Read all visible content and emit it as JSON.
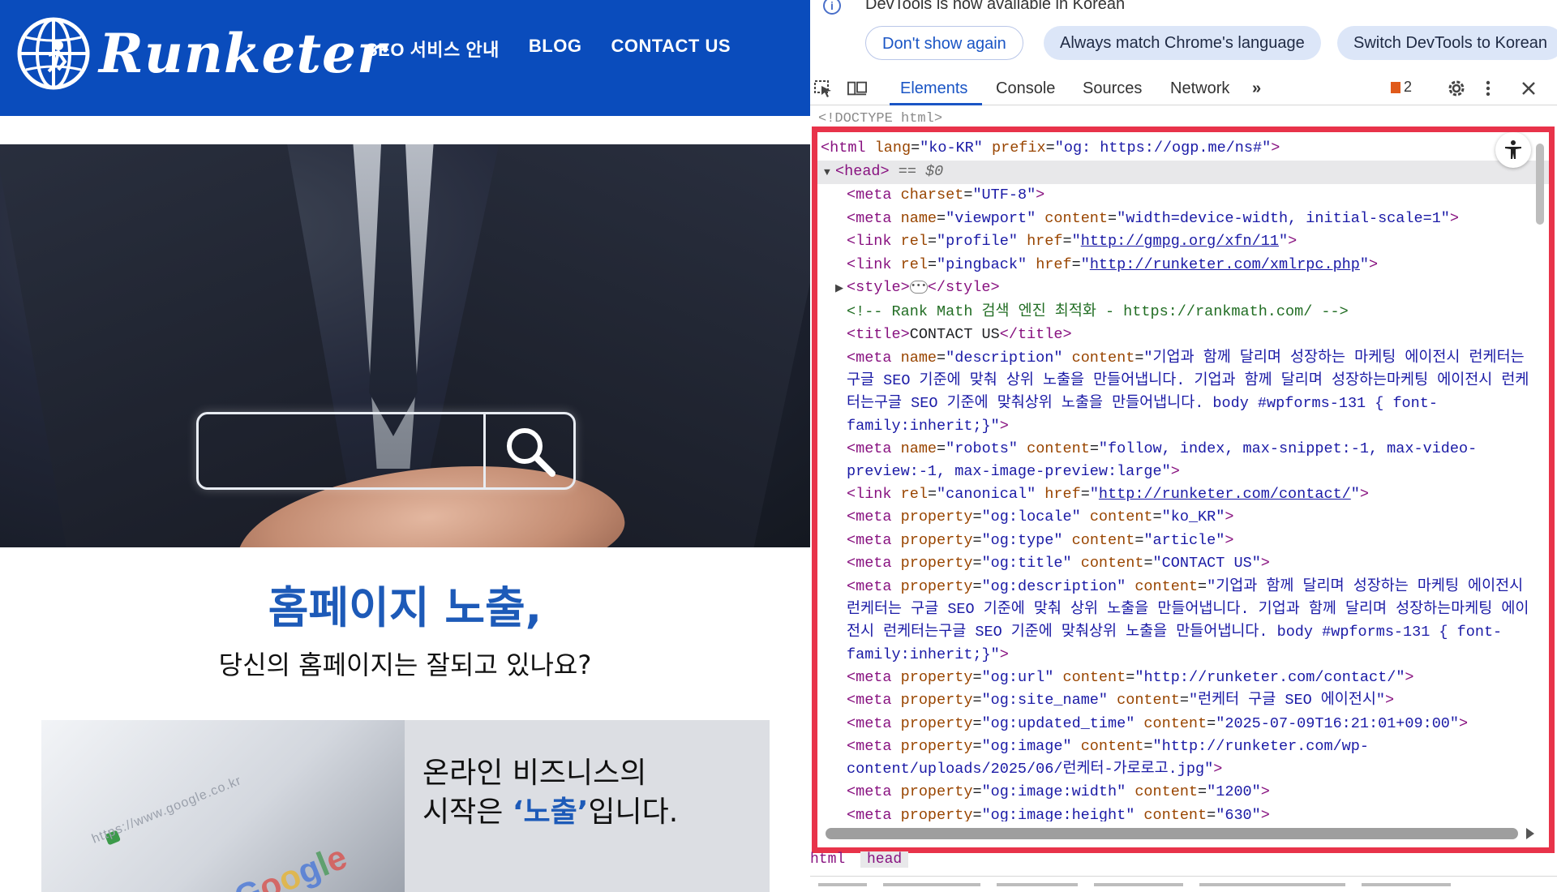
{
  "site": {
    "logo_text": "Runketer",
    "nav": [
      {
        "label": "SEO 서비스 안내"
      },
      {
        "label": "BLOG"
      },
      {
        "label": "CONTACT US"
      }
    ],
    "headline": "홈페이지 노출,",
    "subline": "당신의 홈페이지는 잘되고 있나요?",
    "card": {
      "line1": "온라인 비즈니스의",
      "line2_pre": "시작은 ",
      "line2_highlight": "‘노출’",
      "line2_post": "입니다.",
      "photo_url": "https://www.google.co.kr",
      "photo_brand": "Google"
    },
    "colors": {
      "brand": "#0a4cbc",
      "headline": "#1d5ab8"
    }
  },
  "devtools": {
    "infobar": {
      "message": "DevTools is now available in Korean",
      "buttons": [
        "Don't show again",
        "Always match Chrome's language",
        "Switch DevTools to Korean"
      ]
    },
    "tabs": [
      "Elements",
      "Console",
      "Sources",
      "Network"
    ],
    "active_tab": "Elements",
    "more_tabs": "»",
    "issues_count": "2",
    "doctype": "<!DOCTYPE html>",
    "dom": {
      "html": {
        "tag": "html",
        "attrs": "lang=\"ko-KR\" prefix=\"og: https://ogp.me/ns#\""
      },
      "head_tag": "head",
      "head_ref": "== $0",
      "lines": [
        {
          "tag": "meta",
          "a": "charset",
          "v": "\"UTF-8\""
        },
        {
          "tag": "meta",
          "a": "name",
          "v": "\"viewport\"",
          "a2": "content",
          "v2": "\"width=device-width, initial-scale=1\""
        },
        {
          "tag": "link",
          "a": "rel",
          "v": "\"profile\"",
          "a2": "href",
          "link": "http://gmpg.org/xfn/11"
        },
        {
          "tag": "link",
          "a": "rel",
          "v": "\"pingback\"",
          "a2": "href",
          "link": "http://runketer.com/xmlrpc.php"
        }
      ],
      "style_tag": "style",
      "comment": "<!-- Rank Math 검색 엔진 최적화 - https://rankmath.com/ -->",
      "title_text": "CONTACT US",
      "description": "기업과 함께 달리며 성장하는 마케팅 에이전시 런케터는 구글 SEO 기준에 맞춰 상위 노출을 만들어냅니다. 기업과 함께 달리며 성장하는마케팅 에이전시 런케터는구글 SEO 기준에 맞춰상위 노출을 만들어냅니다. body #wpforms-131 { font-family:inherit;}",
      "robots": "follow, index, max-snippet:-1, max-video-preview:-1, max-image-preview:large",
      "canonical": "http://runketer.com/contact/",
      "og": [
        {
          "p": "og:locale",
          "c": "ko_KR"
        },
        {
          "p": "og:type",
          "c": "article"
        },
        {
          "p": "og:title",
          "c": "CONTACT US"
        }
      ],
      "og_description": "기업과 함께 달리며 성장하는 마케팅 에이전시 런케터는 구글 SEO 기준에 맞춰 상위 노출을 만들어냅니다. 기업과 함께 달리며 성장하는마케팅 에이전시 런케터는구글 SEO 기준에 맞춰상위 노출을 만들어냅니다. body #wpforms-131 { font-family:inherit;}",
      "og2": [
        {
          "p": "og:url",
          "c": "http://runketer.com/contact/"
        },
        {
          "p": "og:site_name",
          "c": "런케터 구글 SEO 에이전시"
        },
        {
          "p": "og:updated_time",
          "c": "2025-07-09T16:21:01+09:00"
        }
      ],
      "og_image": "http://runketer.com/wp-content/uploads/2025/06/런케터-가로로고.jpg",
      "og_image_width": "1200",
      "og_image_height": "630"
    },
    "breadcrumbs": [
      "html",
      "head"
    ]
  }
}
